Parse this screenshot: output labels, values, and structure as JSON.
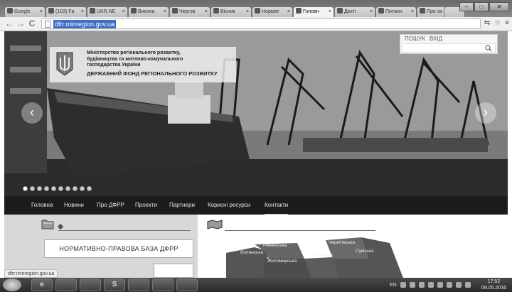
{
  "browser": {
    "tabs": [
      {
        "label": "Google",
        "close": "×"
      },
      {
        "label": "(103) Fa",
        "close": "×"
      },
      {
        "label": "UKR.NE",
        "close": "×"
      },
      {
        "label": "Викона",
        "close": "×"
      },
      {
        "label": "Чергов",
        "close": "×"
      },
      {
        "label": "Вісник",
        "close": "×"
      },
      {
        "label": "Нормат",
        "close": "×"
      },
      {
        "label": "Головн",
        "close": "×"
      },
      {
        "label": "Декті",
        "close": "×"
      },
      {
        "label": "Питанн",
        "close": "×"
      },
      {
        "label": "Про за",
        "close": "×"
      }
    ],
    "window_buttons": {
      "minimize": "–",
      "maximize": "□",
      "close": "✕"
    },
    "nav": {
      "back": "←",
      "forward": "→",
      "reload": "C"
    },
    "url": "dfrr.minregion.gov.ua",
    "toolbar_icons": {
      "translate": "⇆",
      "star": "☆",
      "menu": "≡"
    }
  },
  "site": {
    "search": {
      "label": "ПОШУК",
      "login": "ВХІД"
    },
    "logo": {
      "line1": "Міністерство регіонального розвитку,",
      "line2": "будівництва та житлово-комунального",
      "line3": "господарства України",
      "line4": "ДЕРЖАВНИЙ ФОНД РЕГІОНАЛЬНОГО РОЗВИТКУ"
    },
    "slider": {
      "prev": "‹",
      "next": "›",
      "dot_count": 10,
      "active_dot": 0
    },
    "nav": [
      "Головна",
      "Новини",
      "Про ДФРР",
      "Проекти",
      "Партнери",
      "Корисні ресурси",
      "Контакти"
    ],
    "left_panel": {
      "button": "НОРМАТИВНО-ПРАВОВА БАЗА ДФРР"
    },
    "status_url": "dfrr.minregion.gov.ua",
    "map_regions": [
      "Рівненська",
      "Волинська",
      "Житомирська",
      "Київська",
      "Чернігівська",
      "Сумська"
    ]
  },
  "taskbar": {
    "apps": [
      "e",
      "",
      "",
      "S",
      "",
      "",
      ""
    ],
    "lang": "EN",
    "time": "17:52",
    "date": "09.05.2016"
  }
}
